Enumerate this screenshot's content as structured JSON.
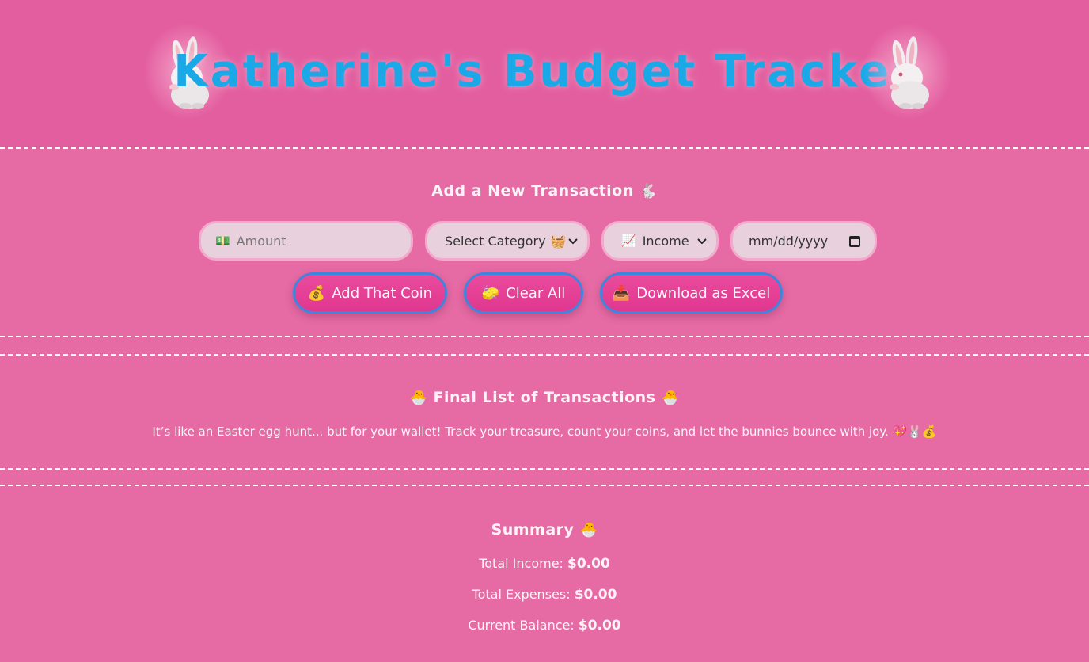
{
  "header": {
    "title": "Katherine's Budget Tracker",
    "left_image": "bunny-image",
    "right_image": "bunny-image"
  },
  "add_section": {
    "title": "Add a New Transaction",
    "title_emoji": "🐇",
    "amount": {
      "icon": "💵",
      "placeholder": "Amount",
      "value": ""
    },
    "category": {
      "selected": "Select Category",
      "emoji": "🧺"
    },
    "type": {
      "icon": "📈",
      "selected": "Income"
    },
    "date": {
      "placeholder": "mm/dd/yyyy"
    },
    "buttons": {
      "add": {
        "emoji": "💰",
        "label": "Add That Coin"
      },
      "clear": {
        "emoji": "🧽",
        "label": "Clear All"
      },
      "download": {
        "emoji": "📥",
        "label": "Download as Excel"
      }
    }
  },
  "list_section": {
    "title": "Final List of Transactions",
    "emoji": "🐣",
    "subtitle": "It’s like an Easter egg hunt... but for your wallet! Track your treasure, count your coins, and let the bunnies bounce with joy. 💖🐰💰"
  },
  "summary": {
    "title": "Summary",
    "emoji": "🐣",
    "income_label": "Total Income:",
    "income_value": "$0.00",
    "expenses_label": "Total Expenses:",
    "expenses_value": "$0.00",
    "balance_label": "Current Balance:",
    "balance_value": "$0.00"
  },
  "colors": {
    "background": "#e66aa4",
    "header_bg": "#e35e9f",
    "title": "#1aa9e6",
    "button": "#e0378f",
    "button_border": "#3d86e0",
    "input_bg": "#e8d1dc"
  }
}
